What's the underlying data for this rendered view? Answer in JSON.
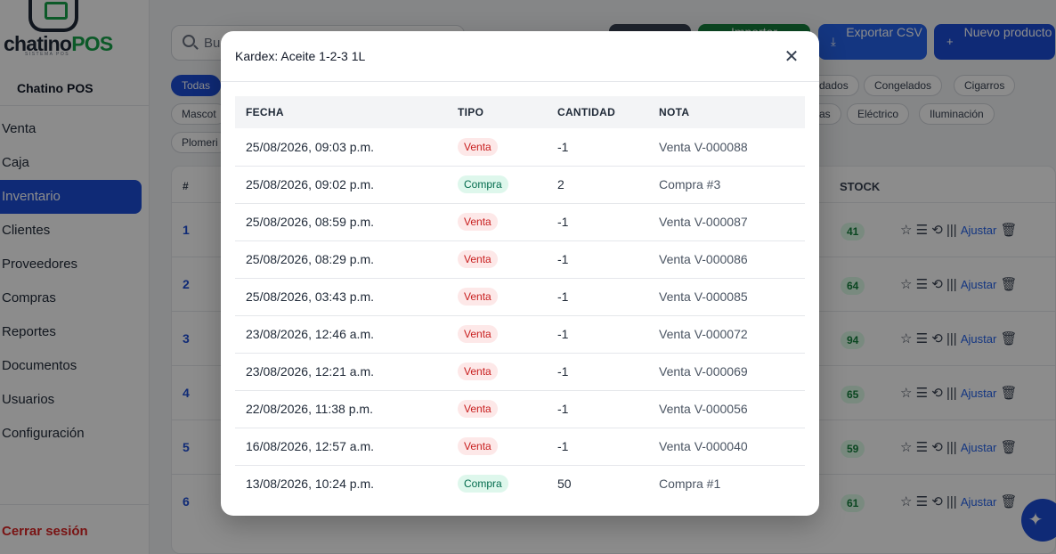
{
  "sidebar": {
    "logo_text": "chatino",
    "logo_accent": "POS",
    "logo_sub": "SISTEMA POS",
    "brand": "Chatino POS",
    "items": [
      {
        "label": "Venta"
      },
      {
        "label": "Caja"
      },
      {
        "label": "Inventario",
        "active": true
      },
      {
        "label": "Clientes"
      },
      {
        "label": "Proveedores"
      },
      {
        "label": "Compras"
      },
      {
        "label": "Reportes"
      },
      {
        "label": "Documentos"
      },
      {
        "label": "Usuarios"
      },
      {
        "label": "Configuración"
      }
    ],
    "logout": "Cerrar sesión"
  },
  "toolbar": {
    "search_placeholder": "Bu",
    "import_label": "Importar",
    "export_label": "Exportar CSV",
    "new_label": "Nuevo producto"
  },
  "filters": {
    "row1": [
      "Todas",
      "dados",
      "Congelados",
      "Cigarros"
    ],
    "row2": [
      "Mascot",
      "as",
      "Eléctrico",
      "Iluminación"
    ],
    "row3": [
      "Plomeri"
    ]
  },
  "background_table": {
    "hash_header": "#",
    "stock_header": "STOCK",
    "adjust_label": "Ajustar",
    "rows": [
      {
        "num": "1",
        "stock": "41"
      },
      {
        "num": "2",
        "stock": "64"
      },
      {
        "num": "3",
        "stock": "94"
      },
      {
        "num": "4",
        "stock": "65"
      },
      {
        "num": "5",
        "stock": "59"
      },
      {
        "num": "6",
        "stock": "61"
      }
    ]
  },
  "modal": {
    "title": "Kardex: Aceite 1-2-3 1L",
    "close_icon": "close-icon",
    "headers": {
      "fecha": "FECHA",
      "tipo": "TIPO",
      "cantidad": "CANTIDAD",
      "nota": "NOTA"
    },
    "rows": [
      {
        "fecha": "25/08/2026, 09:03 p.m.",
        "tipo": "Venta",
        "cantidad": "-1",
        "nota": "Venta V-000088"
      },
      {
        "fecha": "25/08/2026, 09:02 p.m.",
        "tipo": "Compra",
        "cantidad": "2",
        "nota": "Compra #3"
      },
      {
        "fecha": "25/08/2026, 08:59 p.m.",
        "tipo": "Venta",
        "cantidad": "-1",
        "nota": "Venta V-000087"
      },
      {
        "fecha": "25/08/2026, 08:29 p.m.",
        "tipo": "Venta",
        "cantidad": "-1",
        "nota": "Venta V-000086"
      },
      {
        "fecha": "25/08/2026, 03:43 p.m.",
        "tipo": "Venta",
        "cantidad": "-1",
        "nota": "Venta V-000085"
      },
      {
        "fecha": "23/08/2026, 12:46 a.m.",
        "tipo": "Venta",
        "cantidad": "-1",
        "nota": "Venta V-000072"
      },
      {
        "fecha": "23/08/2026, 12:21 a.m.",
        "tipo": "Venta",
        "cantidad": "-1",
        "nota": "Venta V-000069"
      },
      {
        "fecha": "22/08/2026, 11:38 p.m.",
        "tipo": "Venta",
        "cantidad": "-1",
        "nota": "Venta V-000056"
      },
      {
        "fecha": "16/08/2026, 12:57 a.m.",
        "tipo": "Venta",
        "cantidad": "-1",
        "nota": "Venta V-000040"
      },
      {
        "fecha": "13/08/2026, 10:24 p.m.",
        "tipo": "Compra",
        "cantidad": "50",
        "nota": "Compra #1"
      }
    ]
  },
  "colors": {
    "primary": "#1d4ed8",
    "success": "#15803d",
    "danger": "#dc2626",
    "venta_badge_bg": "#fde8e8",
    "compra_badge_bg": "#def7ec"
  }
}
